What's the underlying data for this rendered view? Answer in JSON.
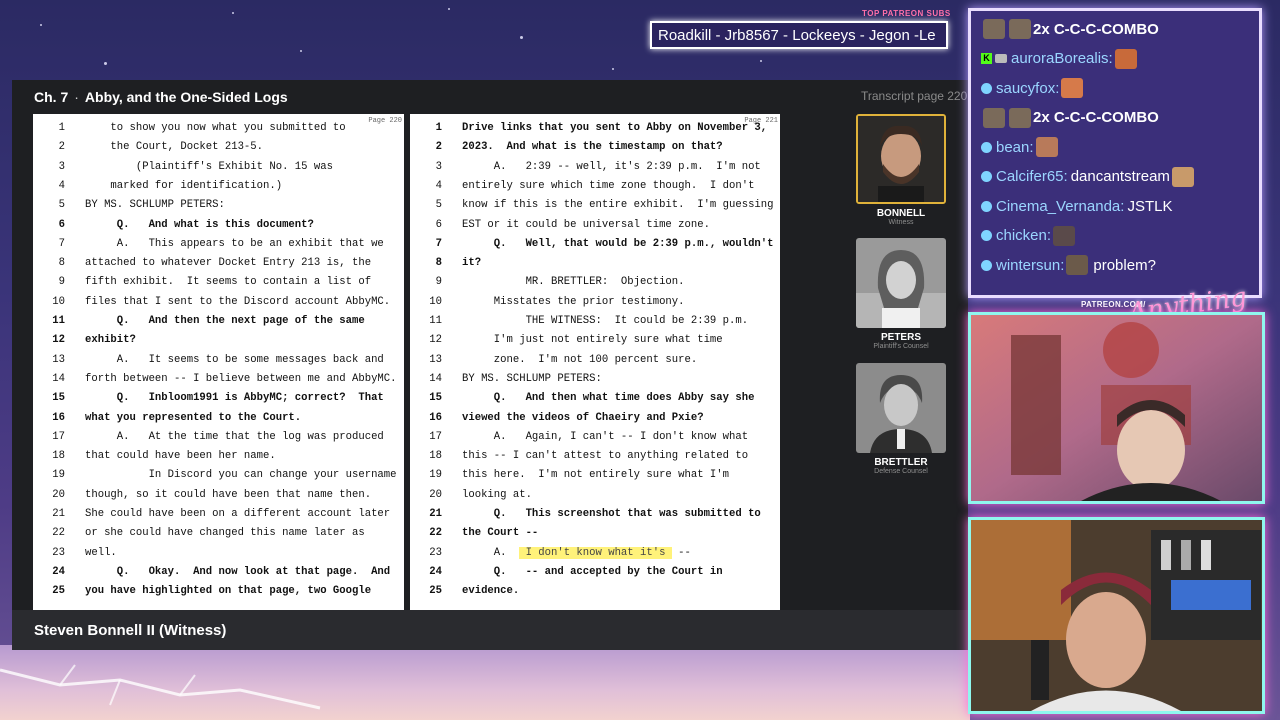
{
  "top_banner": {
    "label": "TOP PATREON SUBS",
    "names": "Roadkill - Jrb8567 - Lockeeys - Jegon -Le"
  },
  "viewer": {
    "chapter": "Ch. 7",
    "separator": "·",
    "title": "Abby, and the One-Sided Logs",
    "page_indicator": "Transcript page 220"
  },
  "transcript_left": {
    "page_number": "Page 220",
    "lines": [
      {
        "n": "1",
        "text": "    to show you now what you submitted to",
        "bold": false
      },
      {
        "n": "2",
        "text": "    the Court, Docket 213-5.",
        "bold": false
      },
      {
        "n": "3",
        "text": "        (Plaintiff's Exhibit No. 15 was",
        "bold": false
      },
      {
        "n": "4",
        "text": "    marked for identification.)",
        "bold": false
      },
      {
        "n": "5",
        "text": "BY MS. SCHLUMP PETERS:",
        "bold": false
      },
      {
        "n": "6",
        "text": "     Q.   And what is this document?",
        "bold": true
      },
      {
        "n": "7",
        "text": "     A.   This appears to be an exhibit that we",
        "bold": false
      },
      {
        "n": "8",
        "text": "attached to whatever Docket Entry 213 is, the",
        "bold": false
      },
      {
        "n": "9",
        "text": "fifth exhibit.  It seems to contain a list of",
        "bold": false
      },
      {
        "n": "10",
        "text": "files that I sent to the Discord account AbbyMC.",
        "bold": false
      },
      {
        "n": "11",
        "text": "     Q.   And then the next page of the same",
        "bold": true
      },
      {
        "n": "12",
        "text": "exhibit?",
        "bold": true
      },
      {
        "n": "13",
        "text": "     A.   It seems to be some messages back and",
        "bold": false
      },
      {
        "n": "14",
        "text": "forth between -- I believe between me and AbbyMC.",
        "bold": false
      },
      {
        "n": "15",
        "text": "     Q.   Inbloom1991 is AbbyMC; correct?  That",
        "bold": true
      },
      {
        "n": "16",
        "text": "what you represented to the Court.",
        "bold": true
      },
      {
        "n": "17",
        "text": "     A.   At the time that the log was produced",
        "bold": false
      },
      {
        "n": "18",
        "text": "that could have been her name.",
        "bold": false
      },
      {
        "n": "19",
        "text": "          In Discord you can change your username",
        "bold": false
      },
      {
        "n": "20",
        "text": "though, so it could have been that name then.",
        "bold": false
      },
      {
        "n": "21",
        "text": "She could have been on a different account later",
        "bold": false
      },
      {
        "n": "22",
        "text": "or she could have changed this name later as",
        "bold": false
      },
      {
        "n": "23",
        "text": "well.",
        "bold": false
      },
      {
        "n": "24",
        "text": "     Q.   Okay.  And now look at that page.  And",
        "bold": true
      },
      {
        "n": "25",
        "text": "you have highlighted on that page, two Google",
        "bold": true
      }
    ]
  },
  "transcript_right": {
    "page_number": "Page 221",
    "lines": [
      {
        "n": "1",
        "text": "Drive links that you sent to Abby on November 3,",
        "bold": true
      },
      {
        "n": "2",
        "text": "2023.  And what is the timestamp on that?",
        "bold": true
      },
      {
        "n": "3",
        "text": "     A.   2:39 -- well, it's 2:39 p.m.  I'm not",
        "bold": false
      },
      {
        "n": "4",
        "text": "entirely sure which time zone though.  I don't",
        "bold": false
      },
      {
        "n": "5",
        "text": "know if this is the entire exhibit.  I'm guessing",
        "bold": false
      },
      {
        "n": "6",
        "text": "EST or it could be universal time zone.",
        "bold": false
      },
      {
        "n": "7",
        "text": "     Q.   Well, that would be 2:39 p.m., wouldn't",
        "bold": true
      },
      {
        "n": "8",
        "text": "it?",
        "bold": true
      },
      {
        "n": "9",
        "text": "          MR. BRETTLER:  Objection.",
        "bold": false
      },
      {
        "n": "10",
        "text": "     Misstates the prior testimony.",
        "bold": false
      },
      {
        "n": "11",
        "text": "          THE WITNESS:  It could be 2:39 p.m.",
        "bold": false
      },
      {
        "n": "12",
        "text": "     I'm just not entirely sure what time",
        "bold": false
      },
      {
        "n": "13",
        "text": "     zone.  I'm not 100 percent sure.",
        "bold": false
      },
      {
        "n": "14",
        "text": "BY MS. SCHLUMP PETERS:",
        "bold": false
      },
      {
        "n": "15",
        "text": "     Q.   And then what time does Abby say she",
        "bold": true
      },
      {
        "n": "16",
        "text": "viewed the videos of Chaeiry and Pxie?",
        "bold": true
      },
      {
        "n": "17",
        "text": "     A.   Again, I can't -- I don't know what",
        "bold": false
      },
      {
        "n": "18",
        "text": "this -- I can't attest to anything related to",
        "bold": false
      },
      {
        "n": "19",
        "text": "this here.  I'm not entirely sure what I'm",
        "bold": false
      },
      {
        "n": "20",
        "text": "looking at.",
        "bold": false
      },
      {
        "n": "21",
        "text": "     Q.   This screenshot that was submitted to",
        "bold": true
      },
      {
        "n": "22",
        "text": "the Court --",
        "bold": true
      },
      {
        "n": "23",
        "text": "     A.  ",
        "bold": false,
        "highlight": " I don't know what it's ",
        "after": " --"
      },
      {
        "n": "24",
        "text": "     Q.   -- and accepted by the Court in",
        "bold": true
      },
      {
        "n": "25",
        "text": "evidence.",
        "bold": true
      }
    ]
  },
  "participants": [
    {
      "name": "BONNELL",
      "role": "Witness",
      "active": true
    },
    {
      "name": "PETERS",
      "role": "Plaintiff's Counsel",
      "active": false
    },
    {
      "name": "BRETTLER",
      "role": "Defense Counsel",
      "active": false
    }
  ],
  "caption": "Steven Bonnell II (Witness)",
  "chat": [
    {
      "user": "",
      "msg": "2x C-C-C-COMBO",
      "type": "combo"
    },
    {
      "user": "auroraBorealis:",
      "msg": "",
      "type": "kick"
    },
    {
      "user": "saucyfox:",
      "msg": "",
      "type": "normal"
    },
    {
      "user": "",
      "msg": "2x C-C-C-COMBO",
      "type": "combo"
    },
    {
      "user": "bean:",
      "msg": "",
      "type": "normal"
    },
    {
      "user": "Calcifer65:",
      "msg": "dancantstream",
      "type": "normal"
    },
    {
      "user": "Cinema_Vernanda:",
      "msg": "JSTLK",
      "type": "normal"
    },
    {
      "user": "chicken:",
      "msg": "",
      "type": "normal"
    },
    {
      "user": "wintersun:",
      "msg": "problem?",
      "type": "normal"
    }
  ],
  "branding": {
    "patreon_url": "PATREON.COM/",
    "script": "Anything Else?"
  },
  "colors": {
    "viewer_bg": "#1e1f22",
    "accent_gold": "#e0b23a",
    "chat_bg": "#3b2f7a",
    "cam_border": "#8ff7ee",
    "highlight": "#fff27a"
  }
}
